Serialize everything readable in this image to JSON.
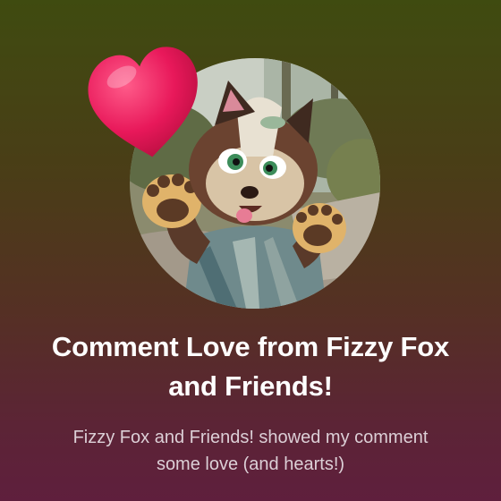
{
  "avatar": {
    "subject": "fursuit-character-photo"
  },
  "reaction": {
    "icon": "heart-icon",
    "color": "#e8185a"
  },
  "title": "Comment Love from Fizzy Fox and Friends!",
  "subtitle": "Fizzy Fox and Friends!  showed my comment some love (and hearts!)",
  "colors": {
    "background_top": "#3f4b10",
    "background_bottom": "#5f1f3d",
    "title_text": "#ffffff",
    "subtitle_text": "#dccfd6"
  }
}
